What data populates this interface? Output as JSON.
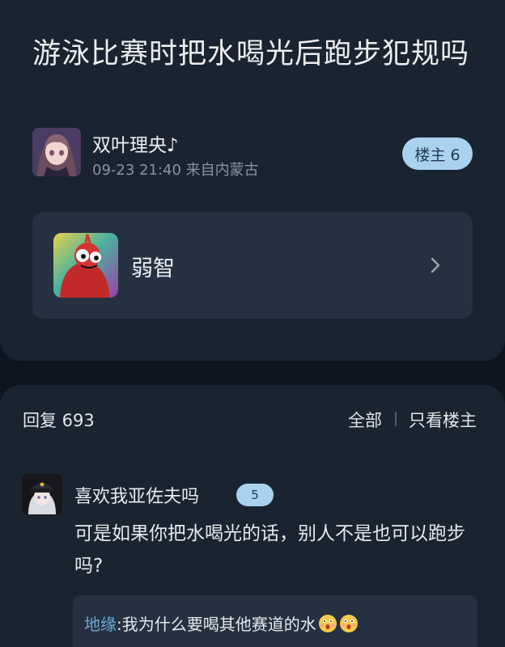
{
  "post": {
    "title": "游泳比赛时把水喝光后跑步犯规吗",
    "author": {
      "name": "双叶理央♪",
      "meta": "09-23 21:40 来自内蒙古",
      "badge": "楼主 6"
    },
    "forum": {
      "name": "弱智"
    }
  },
  "replies": {
    "count_label": "回复 693",
    "filter_all": "全部",
    "filter_owner": "只看楼主",
    "items": [
      {
        "name": "喜欢我亚佐夫吗",
        "level": "5",
        "body": "可是如果你把水喝光的话，别人不是也可以跑步吗?",
        "quote": {
          "user": "地缘",
          "text": ":我为什么要喝其他赛道的水"
        }
      }
    ]
  },
  "colors": {
    "background": "#0d1520",
    "card": "#1a2430",
    "inner_card": "#253140",
    "badge": "#a9d2ef",
    "link": "#6ea8d9"
  },
  "icons": {
    "forum_chevron": "chevron-right-icon",
    "emoji": "surprised-emoji-icon"
  }
}
